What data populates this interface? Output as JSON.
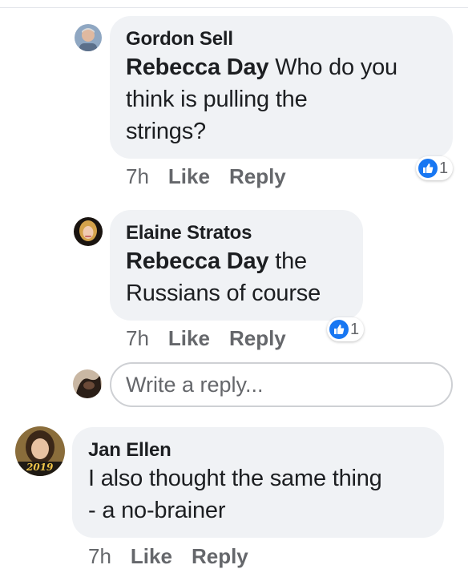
{
  "colors": {
    "accent": "#1877f2",
    "bubble": "#f0f2f5",
    "meta": "#65676b"
  },
  "comments": [
    {
      "author": "Gordon Sell",
      "tag": "Rebecca Day",
      "text_line1": " Who do you",
      "text_line2": "think is pulling the",
      "text_line3": "strings?",
      "time": "7h",
      "like": "Like",
      "reply": "Reply",
      "reaction_count": "1",
      "reaction_icon": "thumbs-up-icon"
    },
    {
      "author": "Elaine Stratos",
      "tag": "Rebecca Day",
      "text_line1": " the",
      "text_line2": "Russians of course",
      "time": "7h",
      "like": "Like",
      "reply": "Reply",
      "reaction_count": "1",
      "reaction_icon": "thumbs-up-icon"
    },
    {
      "author": "Jan Ellen",
      "text_line1": "I also thought the same thing",
      "text_line2": "- a no-brainer",
      "time": "7h",
      "like": "Like",
      "reply": "Reply"
    }
  ],
  "reply_box": {
    "placeholder": "Write a reply..."
  },
  "avatar_badge_text": "2019"
}
